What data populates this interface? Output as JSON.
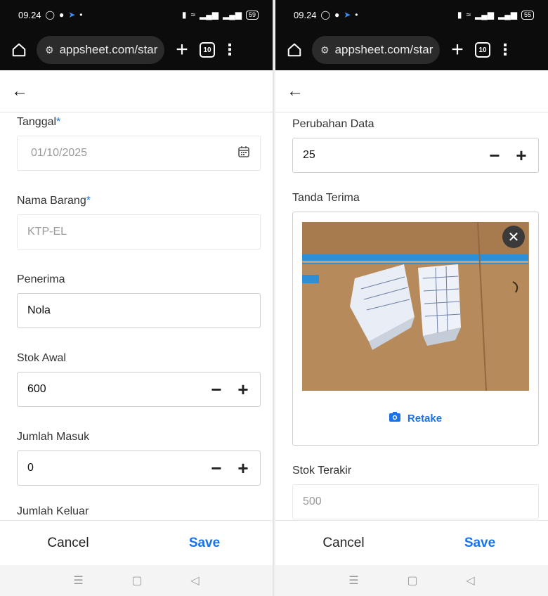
{
  "left": {
    "status": {
      "time": "09.24",
      "battery": "59"
    },
    "url": "appsheet.com/star",
    "tab_count": "10",
    "fields": {
      "tanggal": {
        "label": "Tanggal",
        "required_mark": "*",
        "value": "01/10/2025"
      },
      "nama_barang": {
        "label": "Nama Barang",
        "required_mark": "*",
        "value": "KTP-EL"
      },
      "penerima": {
        "label": "Penerima",
        "value": "Nola"
      },
      "stok_awal": {
        "label": "Stok Awal",
        "value": "600"
      },
      "jumlah_masuk": {
        "label": "Jumlah Masuk",
        "value": "0"
      },
      "jumlah_keluar": {
        "label": "Jumlah Keluar",
        "value": ""
      }
    },
    "footer": {
      "cancel_label": "Cancel",
      "save_label": "Save"
    }
  },
  "right": {
    "status": {
      "time": "09.24",
      "battery": "55"
    },
    "url": "appsheet.com/star",
    "tab_count": "10",
    "fields": {
      "perubahan_data": {
        "label": "Perubahan Data",
        "value": "25"
      },
      "tanda_terima": {
        "label": "Tanda Terima",
        "retake_label": "Retake"
      },
      "stok_terakir": {
        "label": "Stok Terakir",
        "value": "500"
      }
    },
    "footer": {
      "cancel_label": "Cancel",
      "save_label": "Save"
    }
  },
  "icons": {
    "home": "home-icon",
    "tune": "site-settings-icon",
    "plus": "new-tab-icon",
    "tabs": "tab-switcher-icon",
    "menu": "overflow-menu-icon",
    "back": "back-arrow-icon",
    "calendar": "calendar-icon",
    "close": "close-icon",
    "camera": "camera-icon",
    "nav_menu": "nav-menu-icon",
    "nav_home": "nav-home-icon",
    "nav_back": "nav-back-icon"
  },
  "colors": {
    "accent": "#1a73e8",
    "browser_chrome": "#0c0c0c",
    "required": "#1a73e8"
  }
}
